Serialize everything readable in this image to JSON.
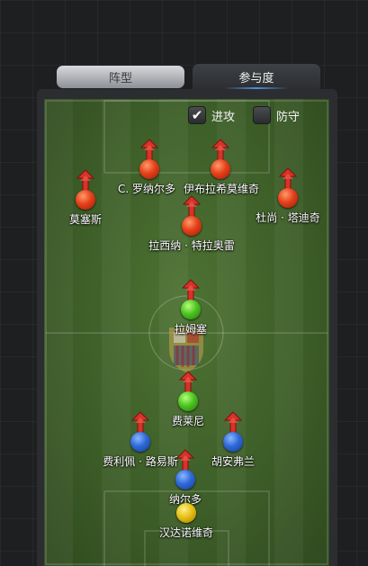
{
  "tabs": {
    "formation": "阵型",
    "participation": "参与度"
  },
  "toggles": {
    "attack": {
      "label": "进攻",
      "checked": true
    },
    "defend": {
      "label": "防守",
      "checked": false
    }
  },
  "colors": {
    "forward": "#e5401a",
    "midfielder": "#4cc522",
    "defender": "#2f69d8",
    "goalkeeper": "#e6c014",
    "arrow": "#d8322a"
  },
  "players": {
    "ronaldo": {
      "name": "C. 罗纳尔多",
      "color": "red",
      "arrow": true
    },
    "ibrahimovic": {
      "name": "伊布拉希莫维奇",
      "color": "red",
      "arrow": true
    },
    "moses": {
      "name": "莫塞斯",
      "color": "red",
      "arrow": true
    },
    "tadic": {
      "name": "杜尚 · 塔迪奇",
      "color": "red",
      "arrow": true
    },
    "lasina": {
      "name": "拉西纳 · 特拉奥雷",
      "color": "red",
      "arrow": true
    },
    "ramsey": {
      "name": "拉姆塞",
      "color": "green",
      "arrow": true
    },
    "fellaini": {
      "name": "费莱尼",
      "color": "green",
      "arrow": true
    },
    "luis": {
      "name": "费利佩 · 路易斯",
      "color": "blue",
      "arrow": true
    },
    "juanfran": {
      "name": "胡安弗兰",
      "color": "blue",
      "arrow": true
    },
    "nacho": {
      "name": "纳尔多",
      "color": "blue",
      "arrow": true
    },
    "handanovic": {
      "name": "汉达诺维奇",
      "color": "yellow",
      "arrow": false
    }
  }
}
